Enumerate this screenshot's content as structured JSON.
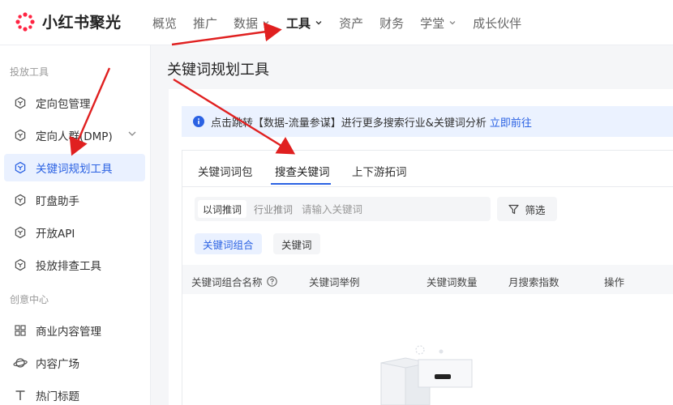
{
  "app": {
    "brand": "小红书聚光",
    "brand_color": "#ff2442",
    "accent": "#2b62e3"
  },
  "nav": {
    "items": [
      {
        "label": "概览"
      },
      {
        "label": "推广"
      },
      {
        "label": "数据"
      },
      {
        "label": "工具"
      },
      {
        "label": "资产"
      },
      {
        "label": "财务"
      },
      {
        "label": "学堂"
      },
      {
        "label": "成长伙伴"
      }
    ]
  },
  "sidebar": {
    "section_launch": "投放工具",
    "section_creative": "创意中心",
    "items": [
      {
        "label": "定向包管理",
        "icon": "hexagon-icon"
      },
      {
        "label": "定向人群(DMP)",
        "icon": "hexagon-icon"
      },
      {
        "label": "关键词规划工具",
        "icon": "hexagon-icon"
      },
      {
        "label": "盯盘助手",
        "icon": "hexagon-icon"
      },
      {
        "label": "开放API",
        "icon": "hexagon-icon"
      },
      {
        "label": "投放排查工具",
        "icon": "hexagon-icon"
      },
      {
        "label": "商业内容管理",
        "icon": "grid-icon"
      },
      {
        "label": "内容广场",
        "icon": "planet-icon"
      },
      {
        "label": "热门标题",
        "icon": "text-icon"
      }
    ]
  },
  "page": {
    "title": "关键词规划工具",
    "banner_text": "点击跳转【数据-流量参谋】进行更多搜索行业&关键词分析",
    "banner_link": "立即前往"
  },
  "tabs": [
    {
      "label": "关键词词包"
    },
    {
      "label": "搜查关键词"
    },
    {
      "label": "上下游拓词"
    }
  ],
  "search": {
    "modes": [
      "以词推词",
      "行业推词"
    ],
    "placeholder": "请输入关键词",
    "value": "",
    "filter_label": "筛选"
  },
  "pills": [
    "关键词组合",
    "关键词"
  ],
  "table": {
    "columns": [
      "关键词组合名称",
      "关键词举例",
      "关键词数量",
      "月搜索指数",
      "操作"
    ]
  }
}
